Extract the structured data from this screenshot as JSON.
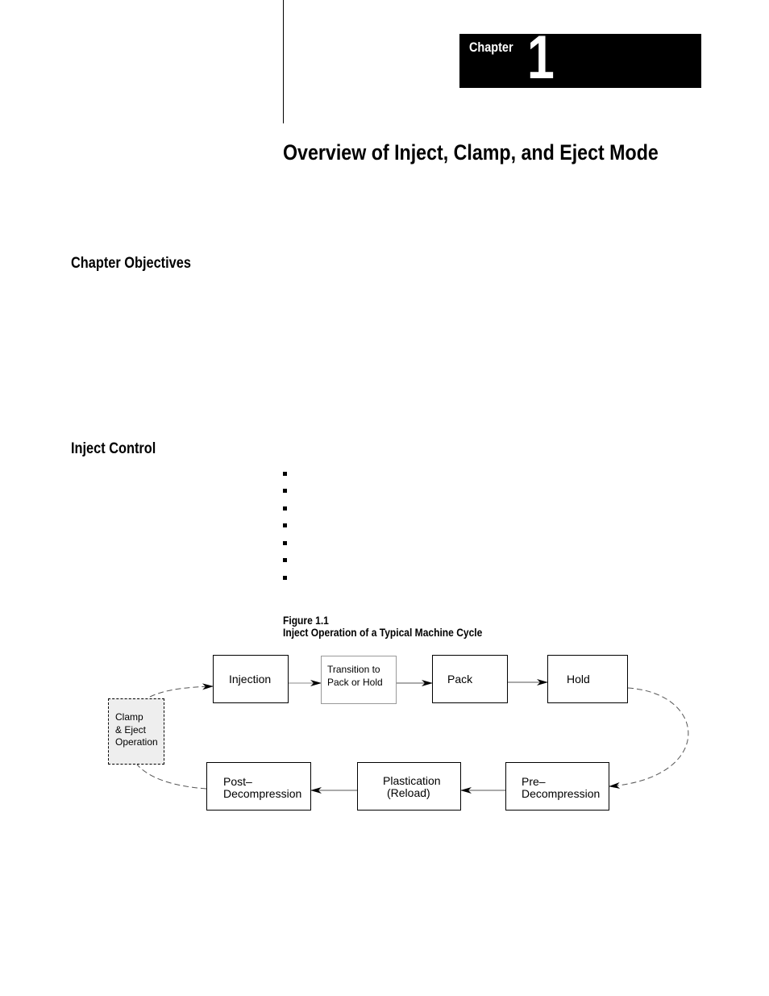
{
  "chapter": {
    "label": "Chapter",
    "number": "1"
  },
  "page_title": "Overview of Inject, Clamp, and Eject Mode",
  "sections": [
    {
      "heading": "Chapter Objectives"
    },
    {
      "heading": "Inject Control",
      "bullets": [
        "",
        "",
        "",
        "",
        "",
        "",
        ""
      ]
    }
  ],
  "figure": {
    "number": "Figure 1.1",
    "caption": "Inject Operation of a Typical Machine Cycle",
    "nodes": {
      "injection": "Injection",
      "transition_1": "Transition  to",
      "transition_2": "Pack or Hold",
      "pack": "Pack",
      "hold": "Hold",
      "pre_1": "Pre–",
      "pre_2": "Decompression",
      "plast_1": "Plastication",
      "plast_2": "(Reload)",
      "post_1": "Post–",
      "post_2": "Decompression",
      "clamp_1": "Clamp",
      "clamp_2": "& Eject",
      "clamp_3": "Operation"
    }
  }
}
